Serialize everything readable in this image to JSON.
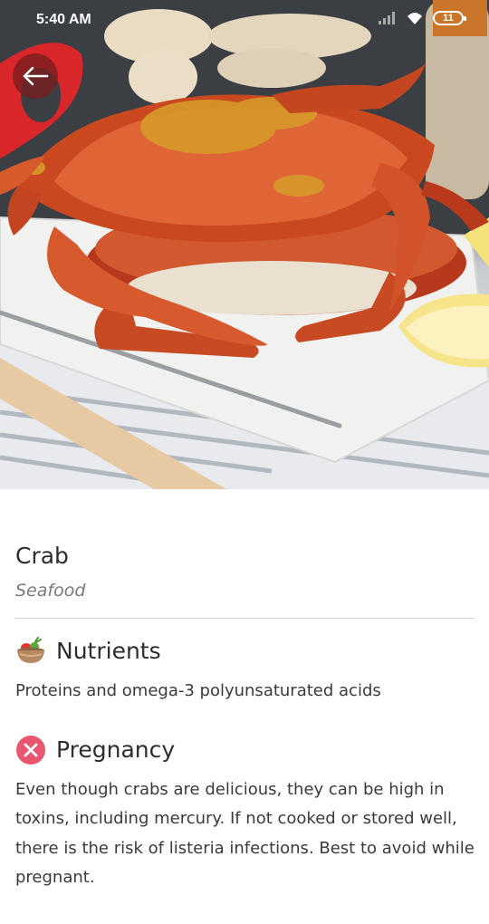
{
  "status_bar": {
    "time": "5:40 AM",
    "battery_level": "11"
  },
  "hero": {
    "image_subject": "steamed-crabs-with-seasoning-and-lemon"
  },
  "navigation": {
    "back_icon": "arrow-left-icon"
  },
  "food": {
    "name": "Crab",
    "category": "Seafood"
  },
  "sections": {
    "nutrients": {
      "icon": "vegetable-bowl-icon",
      "title": "Nutrients",
      "text": "Proteins and omega-3 polyunsaturated acids"
    },
    "pregnancy": {
      "icon": "x-circle-icon",
      "icon_color": "#e8566f",
      "title": "Pregnancy",
      "text": "Even though crabs are delicious, they can be high in toxins, including mercury. If not cooked or stored well, there is the risk of listeria infections. Best to avoid while pregnant."
    }
  }
}
